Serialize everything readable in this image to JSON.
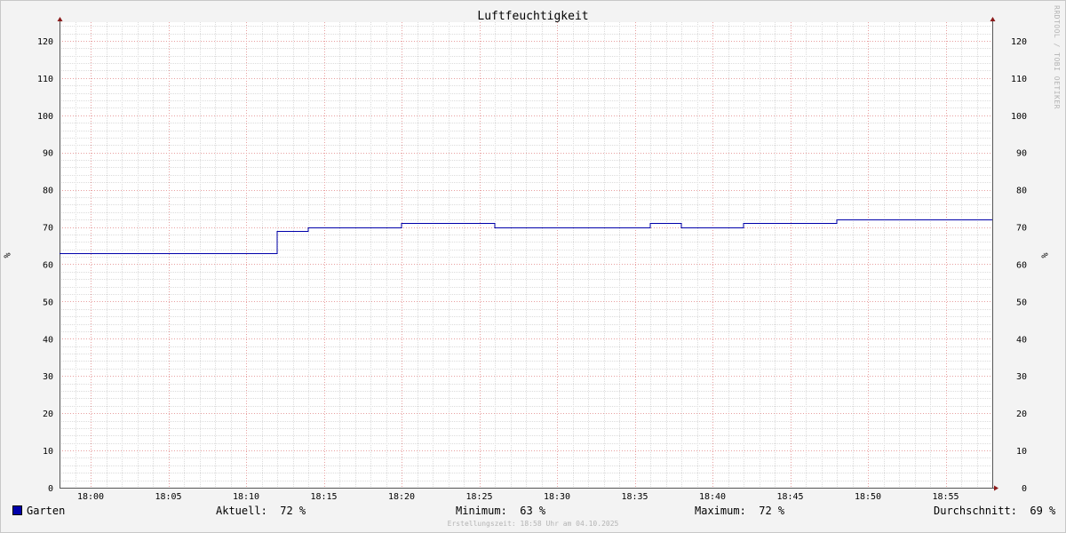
{
  "chart_data": {
    "type": "line",
    "title": "Luftfeuchtigkeit",
    "ylabel": "%",
    "ylim": [
      0,
      125
    ],
    "yticks": [
      0,
      10,
      20,
      30,
      40,
      50,
      60,
      70,
      80,
      90,
      100,
      110,
      120
    ],
    "xlim": [
      "17:58",
      "18:58"
    ],
    "xticks": [
      "18:00",
      "18:05",
      "18:10",
      "18:15",
      "18:20",
      "18:25",
      "18:30",
      "18:35",
      "18:40",
      "18:45",
      "18:50",
      "18:55"
    ],
    "grid": true,
    "series": [
      {
        "name": "Garten",
        "color": "#0000aa",
        "points": [
          [
            "17:58",
            63
          ],
          [
            "18:12",
            63
          ],
          [
            "18:12",
            69
          ],
          [
            "18:14",
            69
          ],
          [
            "18:14",
            70
          ],
          [
            "18:20",
            70
          ],
          [
            "18:20",
            71
          ],
          [
            "18:26",
            71
          ],
          [
            "18:26",
            70
          ],
          [
            "18:36",
            70
          ],
          [
            "18:36",
            71
          ],
          [
            "18:38",
            71
          ],
          [
            "18:38",
            70
          ],
          [
            "18:42",
            70
          ],
          [
            "18:42",
            71
          ],
          [
            "18:48",
            71
          ],
          [
            "18:48",
            72
          ],
          [
            "18:58",
            72
          ]
        ]
      }
    ]
  },
  "legend": {
    "series_name": "Garten",
    "aktuell": "Aktuell:  72 %",
    "minimum": "Minimum:  63 %",
    "maximum": "Maximum:  72 %",
    "durchschnitt": "Durchschnitt:  69 %"
  },
  "footer": "Erstellungszeit: 18:58 Uhr am 04.10.2025",
  "watermark": "RRDTOOL / TOBI OETIKER"
}
